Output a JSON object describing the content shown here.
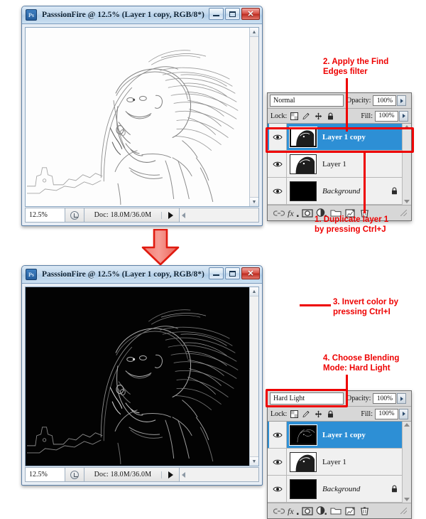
{
  "tutorial": {
    "title": "Photoshop Find Edges / Hard Light tutorial",
    "steps": [
      {
        "id": 1,
        "text": "1. Duplicate layer 1\nby pressing Ctrl+J"
      },
      {
        "id": 2,
        "text": "2. Apply the Find\nEdges filter"
      },
      {
        "id": 3,
        "text": "3. Invert color by\npressing Ctrl+I"
      },
      {
        "id": 4,
        "text": "4. Choose Blending\nMode: Hard Light"
      }
    ],
    "accent_color": "#ee0000",
    "arrow_icon": "down-arrow-icon"
  },
  "windows": [
    {
      "id": "top",
      "app_icon": "photoshop-app-icon",
      "app_icon_text": "Ps",
      "title": "PasssionFire @ 12.5% (Layer 1 copy, RGB/8*)",
      "buttons": {
        "minimize": "minimize-icon",
        "maximize": "maximize-icon",
        "close": "✕"
      },
      "status": {
        "zoom": "12.5%",
        "preview_icon": "document-preview-icon",
        "doc": "Doc: 18.0M/36.0M",
        "expand_icon": "▶"
      },
      "image_state": "find-edges-sketch"
    },
    {
      "id": "bottom",
      "app_icon": "photoshop-app-icon",
      "app_icon_text": "Ps",
      "title": "PasssionFire @ 12.5% (Layer 1 copy, RGB/8*)",
      "buttons": {
        "minimize": "minimize-icon",
        "maximize": "maximize-icon",
        "close": "✕"
      },
      "status": {
        "zoom": "12.5%",
        "preview_icon": "document-preview-icon",
        "doc": "Doc: 18.0M/36.0M",
        "expand_icon": "▶"
      },
      "image_state": "inverted-edges"
    }
  ],
  "layers_panels": [
    {
      "id": "top",
      "blend_mode": "Normal",
      "opacity_label": "Opacity:",
      "opacity_value": "100%",
      "lock_label": "Lock:",
      "lock_icons": [
        "lock-transparent-pixels-icon",
        "lock-image-pixels-icon",
        "lock-position-icon",
        "lock-all-icon"
      ],
      "fill_label": "Fill:",
      "fill_value": "100%",
      "layers": [
        {
          "name": "Layer 1 copy",
          "selected": true,
          "italic": false,
          "locked": false,
          "visible": true,
          "thumb": "edges-thumb"
        },
        {
          "name": "Layer 1",
          "selected": false,
          "italic": false,
          "locked": false,
          "visible": true,
          "thumb": "edges-thumb"
        },
        {
          "name": "Background",
          "selected": false,
          "italic": true,
          "locked": true,
          "visible": true,
          "thumb": "black-thumb"
        }
      ],
      "footer_buttons": [
        "link-layers-icon",
        "layer-style-fx-icon",
        "layer-mask-icon",
        "adjustment-layer-icon",
        "new-group-icon",
        "new-layer-icon",
        "delete-layer-icon"
      ]
    },
    {
      "id": "bottom",
      "blend_mode": "Hard Light",
      "opacity_label": "Opacity:",
      "opacity_value": "100%",
      "lock_label": "Lock:",
      "lock_icons": [
        "lock-transparent-pixels-icon",
        "lock-image-pixels-icon",
        "lock-position-icon",
        "lock-all-icon"
      ],
      "fill_label": "Fill:",
      "fill_value": "100%",
      "layers": [
        {
          "name": "Layer 1 copy",
          "selected": true,
          "italic": false,
          "locked": false,
          "visible": true,
          "thumb": "inverted-thumb"
        },
        {
          "name": "Layer 1",
          "selected": false,
          "italic": false,
          "locked": false,
          "visible": true,
          "thumb": "edges-thumb"
        },
        {
          "name": "Background",
          "selected": false,
          "italic": true,
          "locked": true,
          "visible": true,
          "thumb": "black-thumb"
        }
      ],
      "footer_buttons": [
        "link-layers-icon",
        "layer-style-fx-icon",
        "layer-mask-icon",
        "adjustment-layer-icon",
        "new-group-icon",
        "new-layer-icon",
        "delete-layer-icon"
      ]
    }
  ]
}
